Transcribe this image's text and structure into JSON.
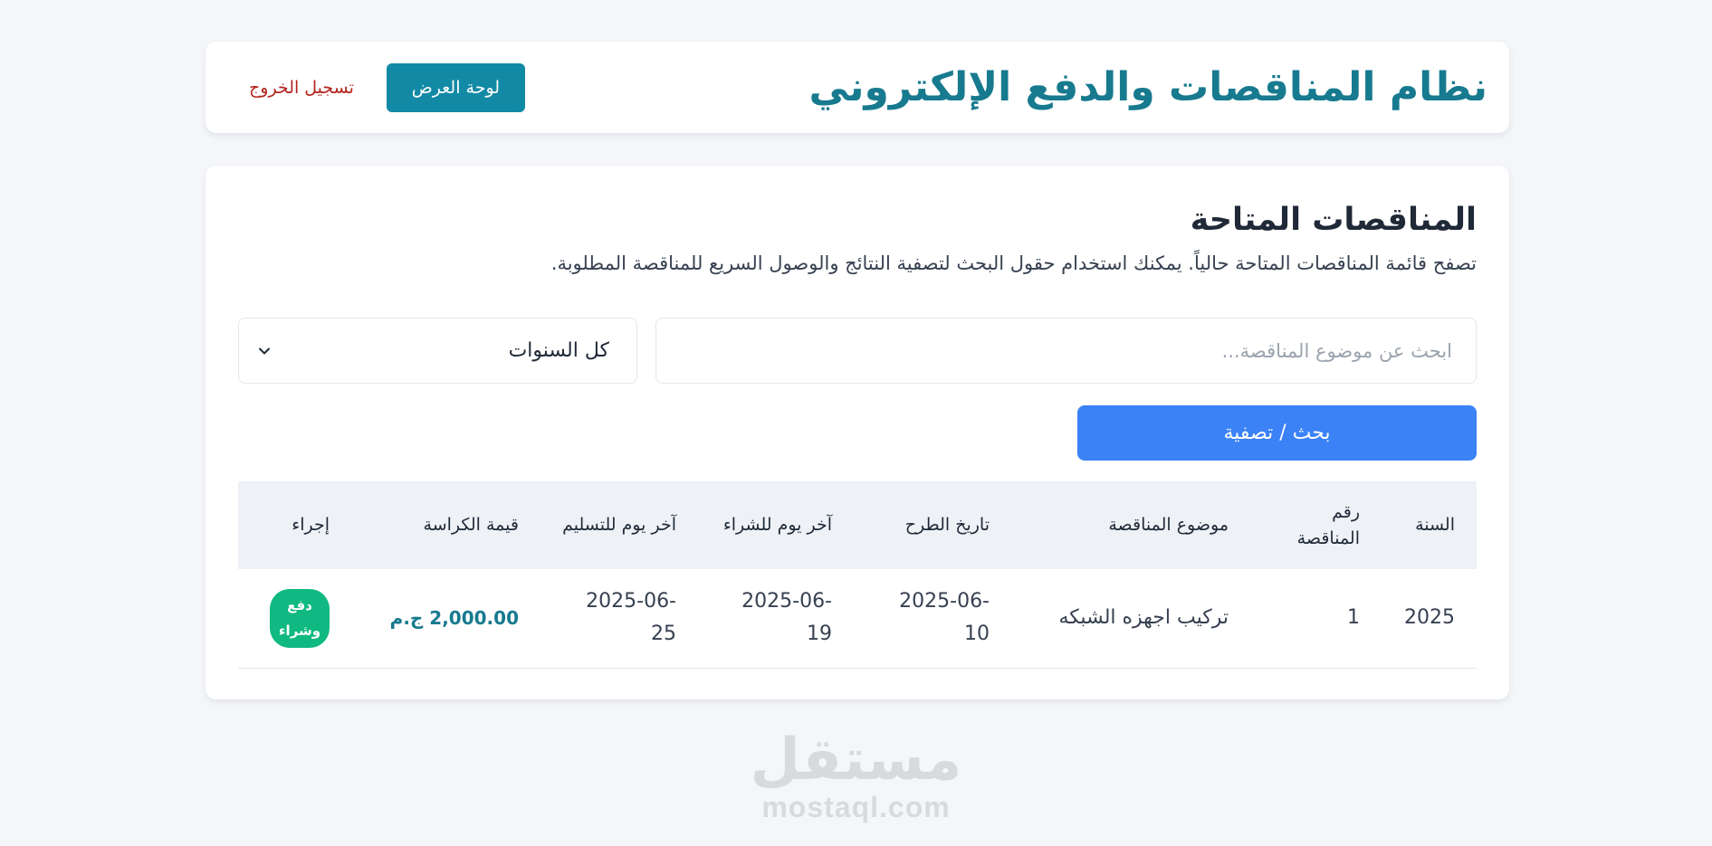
{
  "header": {
    "title": "نظام المناقصات والدفع الإلكتروني",
    "dashboard_label": "لوحة العرض",
    "logout_label": "تسجيل الخروج"
  },
  "main": {
    "title": "المناقصات المتاحة",
    "description": "تصفح قائمة المناقصات المتاحة حالياً. يمكنك استخدام حقول البحث لتصفية النتائج والوصول السريع للمناقصة المطلوبة.",
    "search": {
      "placeholder": "ابحث عن موضوع المناقصة...",
      "value": ""
    },
    "year_select": {
      "selected": "كل السنوات"
    },
    "filter_button_label": "بحث / تصفية",
    "table": {
      "headers": {
        "year": "السنة",
        "number": "رقم المناقصة",
        "subject": "موضوع المناقصة",
        "publish_date": "تاريخ الطرح",
        "last_purchase": "آخر يوم للشراء",
        "last_delivery": "آخر يوم للتسليم",
        "booklet_price": "قيمة الكراسة",
        "action": "إجراء"
      },
      "rows": [
        {
          "year": "2025",
          "number": "1",
          "subject": "تركيب اجهزه الشبكه",
          "publish_date": "2025-06-10",
          "last_purchase": "2025-06-19",
          "last_delivery": "2025-06-25",
          "booklet_price": "2,000.00 ج.م",
          "action_label": "دفع وشراء"
        }
      ]
    }
  },
  "watermark": {
    "arabic": "مستقل",
    "latin": "mostaql.com"
  },
  "colors": {
    "brand": "#177a8f",
    "dashboard_button": "#138aa5",
    "logout": "#b3241d",
    "filter_button": "#3b82f6",
    "pay_button": "#10b981"
  }
}
